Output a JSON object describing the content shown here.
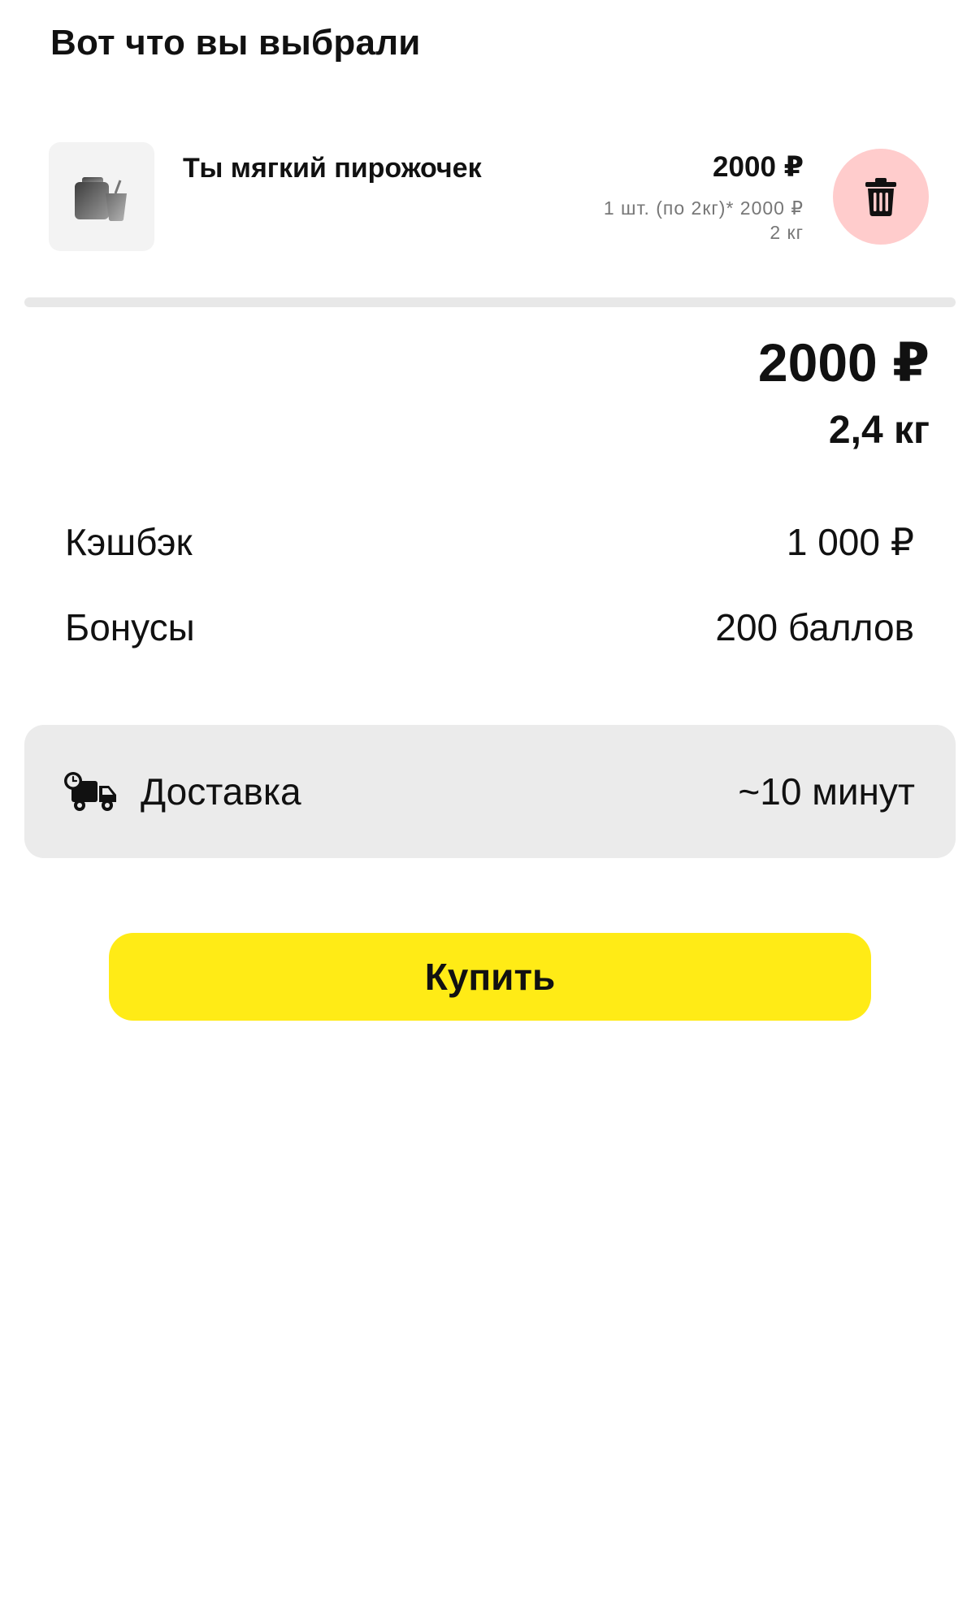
{
  "header": {
    "title": "Вот что вы выбрали"
  },
  "cart_item": {
    "icon": "bag-and-cup-icon",
    "name": "Ты мягкий пирожочек",
    "price": "2000 ₽",
    "detail": "1 шт. (по 2кг)* 2000 ₽",
    "weight": "2 кг",
    "delete_icon": "trash-icon",
    "delete_color": "#ffcccc"
  },
  "summary": {
    "total_price": "2000 ₽",
    "total_weight": "2,4 кг"
  },
  "rewards": {
    "cashback_label": "Кэшбэк",
    "cashback_value": "1 000 ₽",
    "bonus_label": "Бонусы",
    "bonus_value": "200 баллов"
  },
  "delivery": {
    "icon": "delivery-truck-clock-icon",
    "label": "Доставка",
    "time": "~10 минут"
  },
  "actions": {
    "buy_label": "Купить",
    "buy_color": "#ffeb16"
  }
}
